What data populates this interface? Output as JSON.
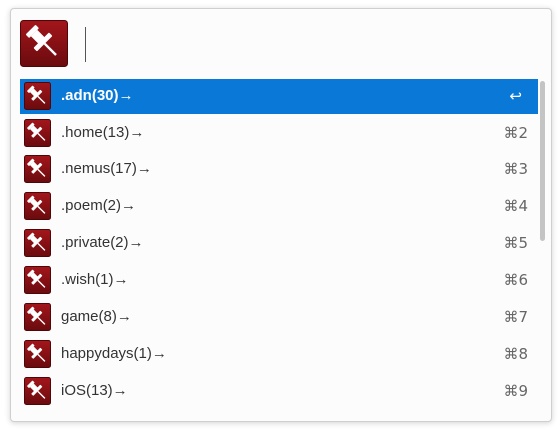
{
  "search": {
    "value": "",
    "placeholder": ""
  },
  "app_icon": "pushpin-icon",
  "colors": {
    "selection": "#0a78d6",
    "icon_bg": "#7d0f13",
    "icon_glyph": "#ffffff"
  },
  "results": [
    {
      "label": ".adn(30)→",
      "shortcut": "↩",
      "selected": true,
      "icon": "pushpin-icon"
    },
    {
      "label": ".home(13)→",
      "shortcut": "⌘2",
      "selected": false,
      "icon": "pushpin-icon"
    },
    {
      "label": ".nemus(17)→",
      "shortcut": "⌘3",
      "selected": false,
      "icon": "pushpin-icon"
    },
    {
      "label": ".poem(2)→",
      "shortcut": "⌘4",
      "selected": false,
      "icon": "pushpin-icon"
    },
    {
      "label": ".private(2)→",
      "shortcut": "⌘5",
      "selected": false,
      "icon": "pushpin-icon"
    },
    {
      "label": ".wish(1)→",
      "shortcut": "⌘6",
      "selected": false,
      "icon": "pushpin-icon"
    },
    {
      "label": "game(8)→",
      "shortcut": "⌘7",
      "selected": false,
      "icon": "pushpin-icon"
    },
    {
      "label": "happydays(1)→",
      "shortcut": "⌘8",
      "selected": false,
      "icon": "pushpin-icon"
    },
    {
      "label": "iOS(13)→",
      "shortcut": "⌘9",
      "selected": false,
      "icon": "pushpin-icon"
    }
  ]
}
